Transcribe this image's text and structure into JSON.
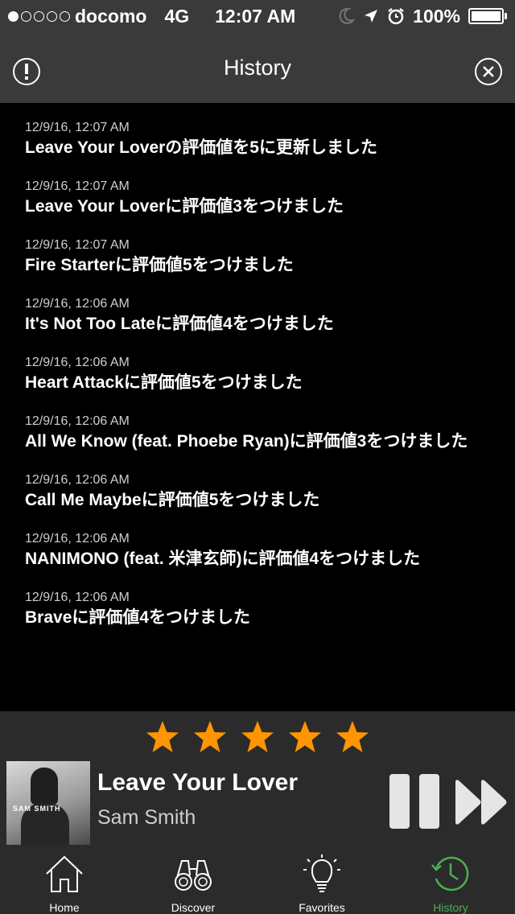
{
  "status_bar": {
    "carrier": "docomo",
    "network": "4G",
    "time": "12:07 AM",
    "battery": "100%",
    "signal_strength": 1
  },
  "nav": {
    "title": "History"
  },
  "history": [
    {
      "date": "12/9/16, 12:07 AM",
      "text": "Leave Your Loverの評価値を5に更新しました"
    },
    {
      "date": "12/9/16, 12:07 AM",
      "text": "Leave Your Loverに評価値3をつけました"
    },
    {
      "date": "12/9/16, 12:07 AM",
      "text": "Fire Starterに評価値5をつけました"
    },
    {
      "date": "12/9/16, 12:06 AM",
      "text": "It's Not Too Lateに評価値4をつけました"
    },
    {
      "date": "12/9/16, 12:06 AM",
      "text": "Heart Attackに評価値5をつけました"
    },
    {
      "date": "12/9/16, 12:06 AM",
      "text": "All We Know (feat. Phoebe Ryan)に評価値3をつけました"
    },
    {
      "date": "12/9/16, 12:06 AM",
      "text": "Call Me Maybeに評価値5をつけました"
    },
    {
      "date": "12/9/16, 12:06 AM",
      "text": "NANIMONO (feat. 米津玄師)に評価値4をつけました"
    },
    {
      "date": "12/9/16, 12:06 AM",
      "text": "Braveに評価値4をつけました"
    }
  ],
  "player": {
    "rating": 5,
    "rating_max": 5,
    "star_color": "#ff9500",
    "track_title": "Leave Your Lover",
    "artist": "Sam Smith",
    "album_label": "SAM SMITH"
  },
  "tabs": [
    {
      "label": "Home",
      "icon": "home-icon",
      "active": false
    },
    {
      "label": "Discover",
      "icon": "binoculars-icon",
      "active": false
    },
    {
      "label": "Favorites",
      "icon": "lightbulb-icon",
      "active": false
    },
    {
      "label": "History",
      "icon": "history-clock-icon",
      "active": true
    }
  ],
  "colors": {
    "accent": "#4caf50",
    "bar_background": "#3a3a3a",
    "panel_background": "#2b2b2b"
  }
}
